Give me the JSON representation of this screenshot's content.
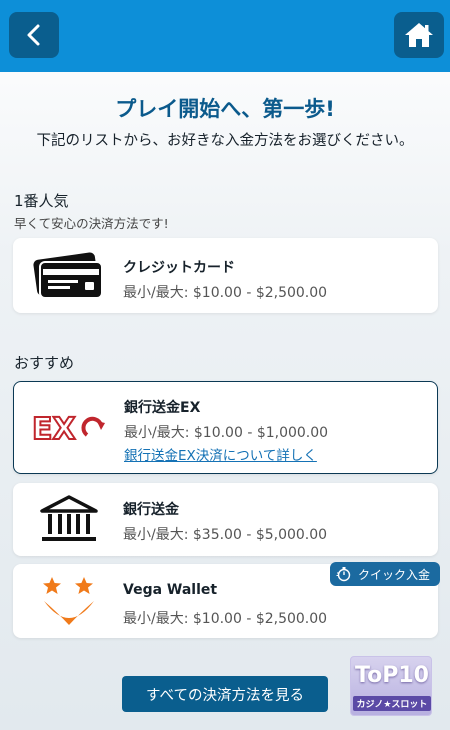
{
  "header": {
    "back_icon": "chevron-left-icon",
    "home_icon": "home-icon",
    "accent_color": "#0d8fd8",
    "button_color": "#0a5e8e"
  },
  "intro": {
    "title": "プレイ開始へ、第一歩!",
    "subtitle": "下記のリストから、お好きな入金方法をお選びください。"
  },
  "popular": {
    "title": "1番人気",
    "subtitle": "早くて安心の決済方法です!",
    "items": [
      {
        "name": "クレジットカード",
        "range": "最小/最大: $10.00 - $2,500.00",
        "icon": "credit-card-icon"
      }
    ]
  },
  "recommended": {
    "title": "おすすめ",
    "items": [
      {
        "name": "銀行送金EX",
        "range": "最小/最大: $10.00 - $1,000.00",
        "link": "銀行送金EX決済について詳しく",
        "icon": "ex-logo-icon",
        "selected": true
      },
      {
        "name": "銀行送金",
        "range": "最小/最大: $35.00 - $5,000.00",
        "icon": "bank-icon"
      },
      {
        "name": "Vega Wallet",
        "range": "最小/最大: $10.00 - $2,500.00",
        "icon": "vega-wallet-icon",
        "badge": "クイック入金"
      }
    ]
  },
  "footer": {
    "see_all_label": "すべての決済方法を見る"
  },
  "watermark": {
    "main": "ToP10",
    "sub": "カジノ★スロット"
  }
}
